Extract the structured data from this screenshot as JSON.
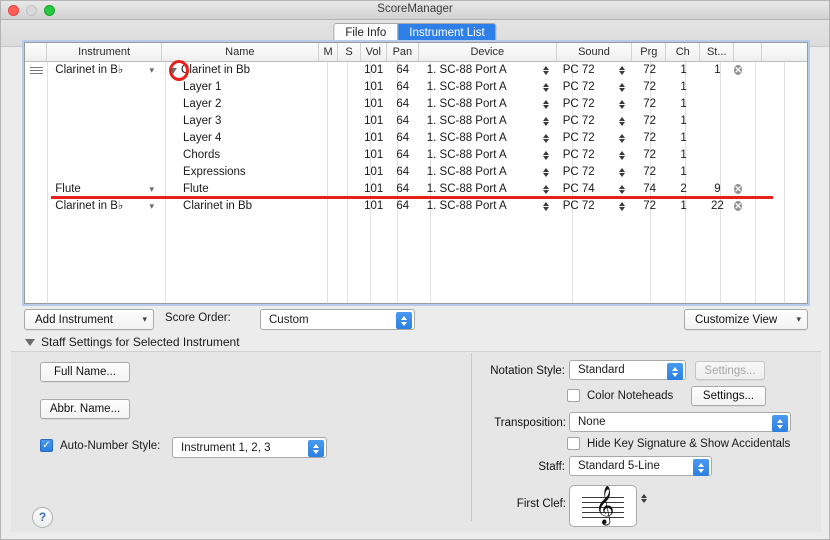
{
  "window": {
    "title": "ScoreManager",
    "traffic": [
      "close",
      "minimize",
      "zoom"
    ]
  },
  "tabs": [
    {
      "label": "File Info",
      "active": false
    },
    {
      "label": "Instrument List",
      "active": true
    }
  ],
  "table": {
    "columns": [
      {
        "key": "handle",
        "label": ""
      },
      {
        "key": "instrument",
        "label": "Instrument"
      },
      {
        "key": "name",
        "label": "Name"
      },
      {
        "key": "m",
        "label": "M"
      },
      {
        "key": "s",
        "label": "S"
      },
      {
        "key": "vol",
        "label": "Vol"
      },
      {
        "key": "pan",
        "label": "Pan"
      },
      {
        "key": "device",
        "label": "Device"
      },
      {
        "key": "sound",
        "label": "Sound"
      },
      {
        "key": "prg",
        "label": "Prg"
      },
      {
        "key": "ch",
        "label": "Ch"
      },
      {
        "key": "st",
        "label": "St..."
      },
      {
        "key": "delete",
        "label": ""
      },
      {
        "key": "pad",
        "label": ""
      }
    ],
    "rows": [
      {
        "handle": true,
        "instrument": "Clarinet in B♭",
        "disclosure": "open",
        "name": "Clarinet in Bb",
        "indent": false,
        "m": "",
        "s": "",
        "vol": "101",
        "pan": "64",
        "device": "1. SC-88 Port A",
        "sound": "PC 72",
        "prg": "72",
        "ch": "1",
        "st": "1",
        "delete": true
      },
      {
        "handle": false,
        "instrument": "",
        "disclosure": "none",
        "name": "Layer 1",
        "indent": true,
        "m": "",
        "s": "",
        "vol": "101",
        "pan": "64",
        "device": "1. SC-88 Port A",
        "sound": "PC 72",
        "prg": "72",
        "ch": "1",
        "st": "",
        "delete": false
      },
      {
        "handle": false,
        "instrument": "",
        "disclosure": "none",
        "name": "Layer 2",
        "indent": true,
        "m": "",
        "s": "",
        "vol": "101",
        "pan": "64",
        "device": "1. SC-88 Port A",
        "sound": "PC 72",
        "prg": "72",
        "ch": "1",
        "st": "",
        "delete": false
      },
      {
        "handle": false,
        "instrument": "",
        "disclosure": "none",
        "name": "Layer 3",
        "indent": true,
        "m": "",
        "s": "",
        "vol": "101",
        "pan": "64",
        "device": "1. SC-88 Port A",
        "sound": "PC 72",
        "prg": "72",
        "ch": "1",
        "st": "",
        "delete": false
      },
      {
        "handle": false,
        "instrument": "",
        "disclosure": "none",
        "name": "Layer 4",
        "indent": true,
        "m": "",
        "s": "",
        "vol": "101",
        "pan": "64",
        "device": "1. SC-88 Port A",
        "sound": "PC 72",
        "prg": "72",
        "ch": "1",
        "st": "",
        "delete": false
      },
      {
        "handle": false,
        "instrument": "",
        "disclosure": "none",
        "name": "Chords",
        "indent": true,
        "m": "",
        "s": "",
        "vol": "101",
        "pan": "64",
        "device": "1. SC-88 Port A",
        "sound": "PC 72",
        "prg": "72",
        "ch": "1",
        "st": "",
        "delete": false
      },
      {
        "handle": false,
        "instrument": "",
        "disclosure": "none",
        "name": "Expressions",
        "indent": true,
        "m": "",
        "s": "",
        "vol": "101",
        "pan": "64",
        "device": "1. SC-88 Port A",
        "sound": "PC 72",
        "prg": "72",
        "ch": "1",
        "st": "",
        "delete": false
      },
      {
        "handle": false,
        "instrument": "Flute",
        "disclosure": "none",
        "name": "Flute",
        "indent": true,
        "m": "",
        "s": "",
        "vol": "101",
        "pan": "64",
        "device": "1. SC-88 Port A",
        "sound": "PC 74",
        "prg": "74",
        "ch": "2",
        "st": "9",
        "delete": true
      },
      {
        "handle": false,
        "instrument": "Clarinet in B♭",
        "disclosure": "none",
        "name": "Clarinet in Bb",
        "indent": true,
        "m": "",
        "s": "",
        "vol": "101",
        "pan": "64",
        "device": "1. SC-88 Port A",
        "sound": "PC 72",
        "prg": "72",
        "ch": "1",
        "st": "22",
        "delete": true
      }
    ]
  },
  "annotations": {
    "ellipse_target": "disclosure-triangle-clarinet-row",
    "underline_target": "flute-row",
    "color": "#e8201a"
  },
  "toolbar": {
    "add_instrument": "Add Instrument",
    "score_order_label": "Score Order:",
    "score_order_value": "Custom",
    "customize_view": "Customize View"
  },
  "staff_settings": {
    "section_title": "Staff Settings for Selected Instrument",
    "full_name_button": "Full Name...",
    "abbr_name_button": "Abbr. Name...",
    "auto_number_label": "Auto-Number Style:",
    "auto_number_checked": true,
    "auto_number_value": "Instrument 1, 2, 3",
    "notation_style_label": "Notation Style:",
    "notation_style_value": "Standard",
    "notation_settings_button": "Settings...",
    "color_noteheads_label": "Color Noteheads",
    "color_noteheads_checked": false,
    "color_settings_button": "Settings...",
    "transposition_label": "Transposition:",
    "transposition_value": "None",
    "hide_key_sig_label": "Hide Key Signature & Show Accidentals",
    "hide_key_sig_checked": false,
    "staff_label": "Staff:",
    "staff_value": "Standard 5-Line",
    "first_clef_label": "First Clef:",
    "first_clef_glyph": "𝄞"
  },
  "help": {
    "glyph": "?"
  },
  "colors": {
    "accent": "#2f7fe8",
    "annotation": "#e8201a",
    "window_bg": "#ececec",
    "table_bg": "#ffffff"
  }
}
